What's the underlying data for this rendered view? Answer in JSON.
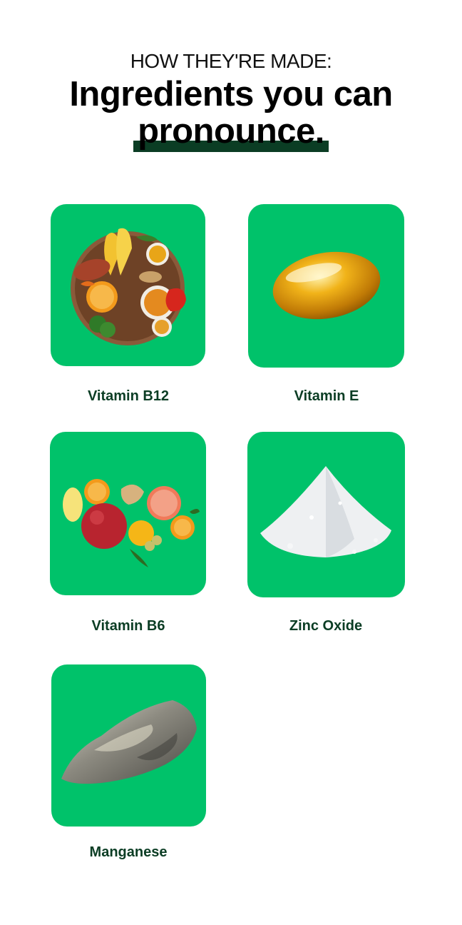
{
  "header": {
    "eyebrow": "HOW THEY'RE MADE:",
    "headline_line1": "Ingredients you can",
    "headline_line2": "pronounce."
  },
  "ingredients": [
    {
      "label": "Vitamin B12",
      "icon": "food-platter-icon"
    },
    {
      "label": "Vitamin E",
      "icon": "softgel-capsule-icon"
    },
    {
      "label": "Vitamin B6",
      "icon": "fruits-icon"
    },
    {
      "label": "Zinc Oxide",
      "icon": "white-powder-icon"
    },
    {
      "label": "Manganese",
      "icon": "mineral-rock-icon"
    }
  ],
  "colors": {
    "card_bg": "#00c26a",
    "label_text": "#0b3d24",
    "underline": "#0b3d24"
  }
}
